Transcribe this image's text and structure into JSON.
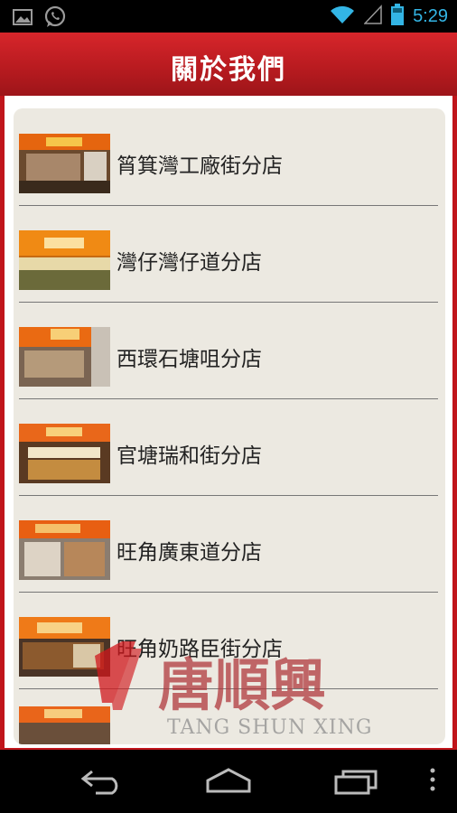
{
  "statusbar": {
    "time": "5:29"
  },
  "header": {
    "title": "關於我們"
  },
  "stores": [
    {
      "name": "筲箕灣工廠街分店"
    },
    {
      "name": "灣仔灣仔道分店"
    },
    {
      "name": "西環石塘咀分店"
    },
    {
      "name": "官塘瑞和街分店"
    },
    {
      "name": "旺角廣東道分店"
    },
    {
      "name": "旺角奶路臣街分店"
    }
  ],
  "watermark": {
    "brand_chinese": "唐順興",
    "brand_english": "TANG SHUN XING"
  },
  "colors": {
    "header_red": "#c0151b",
    "status_blue": "#33b5e5",
    "card_bg": "#ece9e1"
  }
}
